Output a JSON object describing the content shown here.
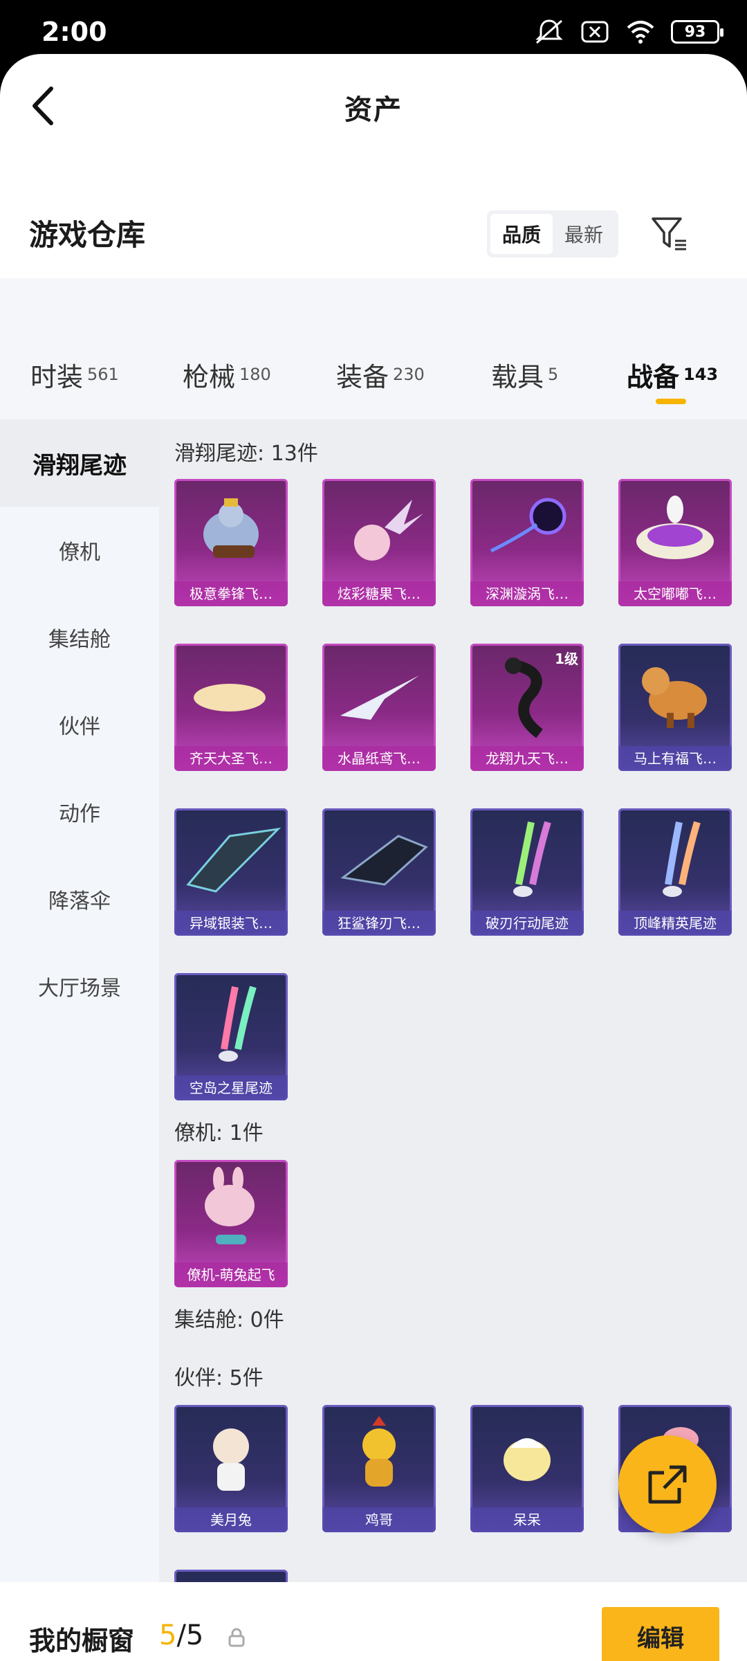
{
  "status": {
    "time": "2:00",
    "battery": "93"
  },
  "header": {
    "title": "资产"
  },
  "warehouse": {
    "title": "游戏仓库",
    "sort_options": [
      "品质",
      "最新"
    ],
    "active_sort": 0
  },
  "categories": [
    {
      "name": "时装",
      "count": "561"
    },
    {
      "name": "枪械",
      "count": "180"
    },
    {
      "name": "装备",
      "count": "230"
    },
    {
      "name": "载具",
      "count": "5"
    },
    {
      "name": "战备",
      "count": "143"
    }
  ],
  "active_category": 4,
  "sidebar": {
    "items": [
      "滑翔尾迹",
      "僚机",
      "集结舱",
      "伙伴",
      "动作",
      "降落伞",
      "大厅场景"
    ],
    "active": 0
  },
  "sections": {
    "glide": {
      "title": "滑翔尾迹: 13件",
      "items": [
        {
          "label": "极意拳锋飞…",
          "rarity": "purple"
        },
        {
          "label": "炫彩糖果飞…",
          "rarity": "purple"
        },
        {
          "label": "深渊漩涡飞…",
          "rarity": "purple"
        },
        {
          "label": "太空嘟嘟飞…",
          "rarity": "purple"
        },
        {
          "label": "齐天大圣飞…",
          "rarity": "purple"
        },
        {
          "label": "水晶纸鸢飞…",
          "rarity": "purple"
        },
        {
          "label": "龙翔九天飞…",
          "rarity": "purple",
          "level": "1级"
        },
        {
          "label": "马上有福飞…",
          "rarity": "blue"
        },
        {
          "label": "异域银装飞…",
          "rarity": "blue"
        },
        {
          "label": "狂鲨锋刃飞…",
          "rarity": "blue"
        },
        {
          "label": "破刃行动尾迹",
          "rarity": "blue"
        },
        {
          "label": "顶峰精英尾迹",
          "rarity": "blue"
        },
        {
          "label": "空岛之星尾迹",
          "rarity": "blue"
        }
      ]
    },
    "wingman": {
      "title": "僚机: 1件",
      "items": [
        {
          "label": "僚机-萌兔起飞",
          "rarity": "purple"
        }
      ]
    },
    "pod": {
      "title": "集结舱: 0件"
    },
    "partner": {
      "title": "伙伴: 5件",
      "items": [
        {
          "label": "美月兔",
          "rarity": "blue"
        },
        {
          "label": "鸡哥",
          "rarity": "blue"
        },
        {
          "label": "呆呆",
          "rarity": "blue"
        },
        {
          "label": "",
          "rarity": "blue"
        }
      ]
    }
  },
  "bottom": {
    "shelf_title": "我的橱窗",
    "shelf_current": "5",
    "shelf_total": "/5",
    "edit_label": "编辑"
  },
  "colors": {
    "accent": "#f6b400",
    "purple_card": "#8a2a86",
    "blue_card": "#34306a"
  }
}
